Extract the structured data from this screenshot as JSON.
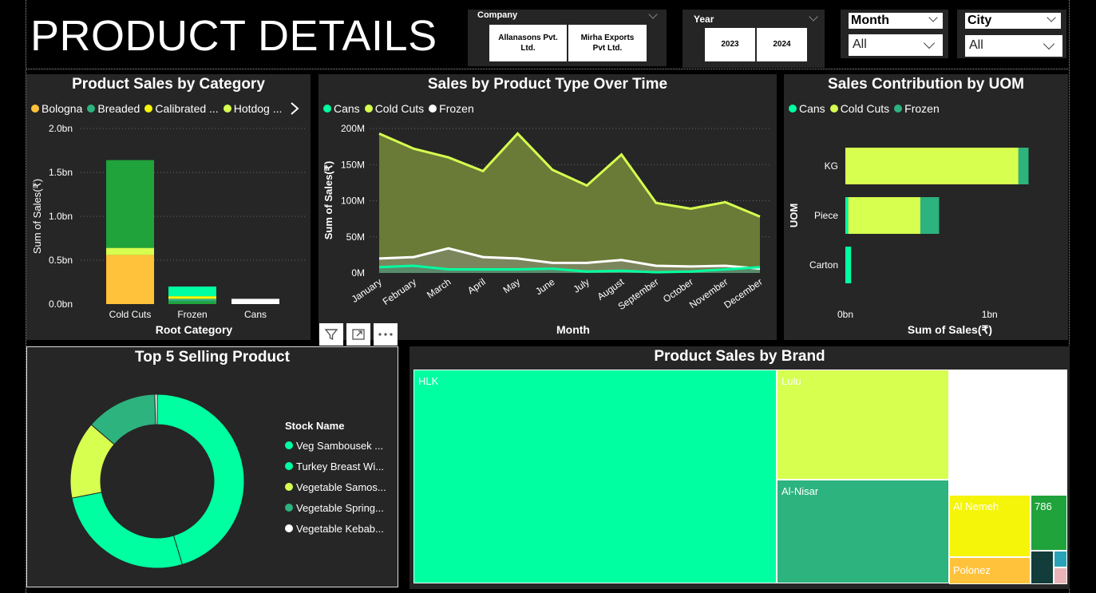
{
  "page_title": "PRODUCT DETAILS",
  "slicers": {
    "company": {
      "label": "Company",
      "options": [
        "Allanasons Pvt. Ltd.",
        "Mirha Exports Pvt Ltd."
      ]
    },
    "year": {
      "label": "Year",
      "options": [
        "2023",
        "2024"
      ]
    },
    "month": {
      "label": "Month",
      "value": "All"
    },
    "city": {
      "label": "City",
      "value": "All"
    }
  },
  "colors": {
    "panel": "#262626",
    "spring_green": "#00FFA0",
    "lime": "#D6FF4F",
    "sea_green": "#2DB37E",
    "green": "#1FA33A",
    "yellow": "#F5F50A",
    "orange": "#FFC23A",
    "white": "#FFFFFF",
    "olive_fill": "#6A7A37"
  },
  "chart_data": [
    {
      "id": "category",
      "type": "bar",
      "stacked": true,
      "title": "Product Sales by Category",
      "xlabel": "Root Category",
      "ylabel": "Sum of Sales(₹)",
      "categories": [
        "Cold Cuts",
        "Frozen",
        "Cans"
      ],
      "ylim": [
        0,
        2.0
      ],
      "yticks": [
        "0.0bn",
        "0.5bn",
        "1.0bn",
        "1.5bn",
        "2.0bn"
      ],
      "legend": [
        "Bologna",
        "Breaded",
        "Calibrated ...",
        "Hotdog ..."
      ],
      "legend_colors": [
        "#FFC23A",
        "#2DB37E",
        "#F5F50A",
        "#D6FF4F"
      ],
      "series": [
        {
          "name": "Bologna",
          "color": "#FFC23A",
          "values": [
            0.56,
            0.0,
            0.0
          ]
        },
        {
          "name": "Hotdog",
          "color": "#D6FF4F",
          "values": [
            0.08,
            0.0,
            0.0
          ]
        },
        {
          "name": "",
          "color": "#1FA33A",
          "values": [
            1.0,
            0.03,
            0.0
          ]
        },
        {
          "name": "",
          "color": "#2DB37E",
          "values": [
            0.0,
            0.03,
            0.0
          ]
        },
        {
          "name": "",
          "color": "#F5F50A",
          "values": [
            0.0,
            0.03,
            0.0
          ]
        },
        {
          "name": "",
          "color": "#00FFA0",
          "values": [
            0.0,
            0.11,
            0.0
          ]
        },
        {
          "name": "",
          "color": "#FFFFFF",
          "values": [
            0.0,
            0.0,
            0.06
          ]
        }
      ]
    },
    {
      "id": "time",
      "type": "area",
      "title": "Sales by Product Type Over Time",
      "xlabel": "Month",
      "ylabel": "Sum of Sales(₹)",
      "categories": [
        "January",
        "February",
        "March",
        "April",
        "May",
        "June",
        "July",
        "August",
        "September",
        "October",
        "November",
        "December"
      ],
      "ylim": [
        0,
        200
      ],
      "yticks": [
        "0M",
        "50M",
        "100M",
        "150M",
        "200M"
      ],
      "legend": [
        "Cans",
        "Cold Cuts",
        "Frozen"
      ],
      "series": [
        {
          "name": "Cold Cuts",
          "color": "#D6FF4F",
          "values": [
            193,
            172,
            160,
            141,
            193,
            143,
            121,
            164,
            97,
            89,
            98,
            78
          ]
        },
        {
          "name": "Frozen",
          "color": "#FFFFFF",
          "values": [
            20,
            22,
            34,
            22,
            20,
            14,
            14,
            18,
            10,
            9,
            10,
            6
          ]
        },
        {
          "name": "Cans",
          "color": "#00FFA0",
          "values": [
            8,
            10,
            5,
            5,
            5,
            6,
            2,
            3,
            1,
            2,
            5,
            8
          ]
        }
      ]
    },
    {
      "id": "uom",
      "type": "bar",
      "orientation": "horizontal",
      "stacked": true,
      "title": "Sales Contribution by UOM",
      "xlabel": "Sum of Sales(₹)",
      "ylabel": "UOM",
      "categories": [
        "KG",
        "Piece",
        "Carton"
      ],
      "xticks": [
        "0bn",
        "1bn"
      ],
      "xlim": [
        0,
        1.4
      ],
      "legend": [
        "Cans",
        "Cold Cuts",
        "Frozen"
      ],
      "series": [
        {
          "name": "Cans",
          "color": "#00FFA0",
          "values": [
            0.0,
            0.02,
            0.04
          ]
        },
        {
          "name": "Cold Cuts",
          "color": "#D6FF4F",
          "values": [
            1.2,
            0.5,
            0.0
          ]
        },
        {
          "name": "Frozen",
          "color": "#2DB37E",
          "values": [
            0.07,
            0.13,
            0.0
          ]
        }
      ]
    },
    {
      "id": "donut",
      "type": "pie",
      "donut": true,
      "title": "Top 5 Selling Product",
      "legend_title": "Stock Name",
      "labels": [
        "Veg Sambousek ...",
        "Turkey Breast Wi...",
        "Vegetable Samos...",
        "Vegetable Spring...",
        "Vegetable Kebab..."
      ],
      "colors": [
        "#00FFA0",
        "#00FFA0",
        "#D6FF4F",
        "#2DB37E",
        "#FFFFFF"
      ],
      "values": [
        41,
        24,
        13,
        12,
        0.4
      ]
    },
    {
      "id": "treemap",
      "type": "treemap",
      "title": "Product Sales by Brand",
      "items": [
        {
          "label": "HLK",
          "color": "#00FFA0",
          "value": 57
        },
        {
          "label": "Lulu",
          "color": "#D6FF4F",
          "value": 12
        },
        {
          "label": "",
          "color": "#FFFFFF",
          "value": 10
        },
        {
          "label": "Al-Nisar",
          "color": "#2DB37E",
          "value": 11
        },
        {
          "label": "Al Nemeh",
          "color": "#F5F50A",
          "value": 4
        },
        {
          "label": "786",
          "color": "#1FA33A",
          "value": 2
        },
        {
          "label": "Polonez",
          "color": "#FFC23A",
          "value": 2
        }
      ]
    }
  ]
}
